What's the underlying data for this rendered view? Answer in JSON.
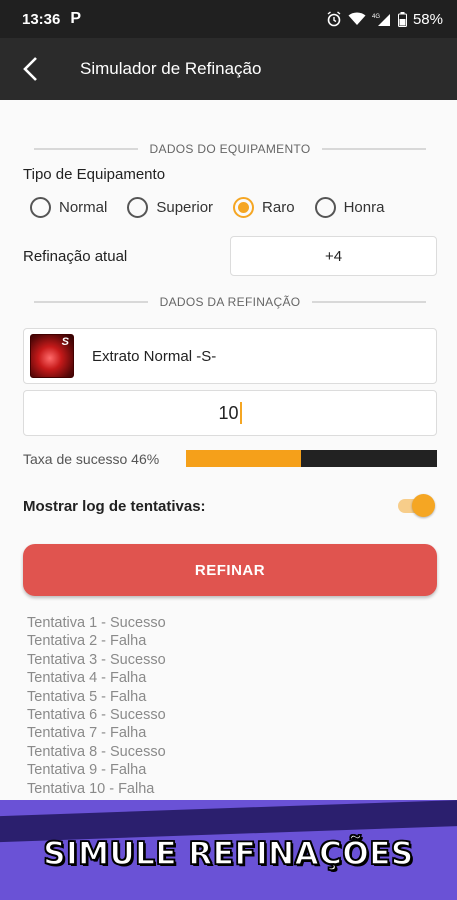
{
  "status_bar": {
    "time": "13:36",
    "app_icon": "P",
    "battery": "58%",
    "network": "4G"
  },
  "app_bar": {
    "title": "Simulador de Refinação"
  },
  "equipment_section": {
    "title": "DADOS DO EQUIPAMENTO"
  },
  "equipment_type": {
    "label": "Tipo de Equipamento",
    "options": [
      "Normal",
      "Superior",
      "Raro",
      "Honra"
    ],
    "selected": "Raro"
  },
  "current_refine": {
    "label": "Refinação atual",
    "value": "+4"
  },
  "refine_section": {
    "title": "DADOS DA REFINAÇÃO"
  },
  "item": {
    "name": "Extrato Normal -S-",
    "badge": "S"
  },
  "quantity": {
    "value": "10"
  },
  "success_rate": {
    "label": "Taxa de sucesso 46%",
    "value": 0.46
  },
  "show_log": {
    "label": "Mostrar log de tentativas:",
    "enabled": true
  },
  "refine_button": {
    "label": "REFINAR"
  },
  "log": [
    "Tentativa 1 - Sucesso",
    "Tentativa 2 - Falha",
    "Tentativa 3 - Sucesso",
    "Tentativa 4 - Falha",
    "Tentativa 5 - Falha",
    "Tentativa 6 - Sucesso",
    "Tentativa 7 - Falha",
    "Tentativa 8 - Sucesso",
    "Tentativa 9 - Falha",
    "Tentativa 10 - Falha"
  ],
  "banner": {
    "text": "SIMULE REFINAÇÕES"
  },
  "colors": {
    "accent": "#f5a623",
    "button": "#e0544f",
    "banner": "#6a52d6"
  }
}
